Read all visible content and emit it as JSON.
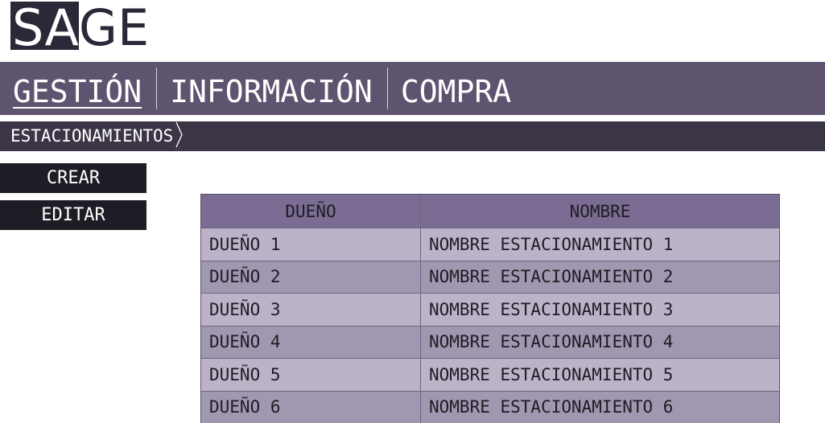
{
  "logo": {
    "part_dark": "SA",
    "part_light": "GE"
  },
  "nav": {
    "items": [
      {
        "label": "GESTIÓN",
        "active": true
      },
      {
        "label": "INFORMACIÓN",
        "active": false
      },
      {
        "label": "COMPRA",
        "active": false
      }
    ]
  },
  "breadcrumb": {
    "label": "ESTACIONAMIENTOS",
    "icon": "chevron-right-icon"
  },
  "actions": {
    "crear": "CREAR",
    "editar": "EDITAR"
  },
  "table": {
    "headers": [
      "DUEÑO",
      "NOMBRE"
    ],
    "rows": [
      [
        "DUEÑO 1",
        "NOMBRE ESTACIONAMIENTO 1"
      ],
      [
        "DUEÑO 2",
        "NOMBRE ESTACIONAMIENTO 2"
      ],
      [
        "DUEÑO 3",
        "NOMBRE ESTACIONAMIENTO 3"
      ],
      [
        "DUEÑO 4",
        "NOMBRE ESTACIONAMIENTO 4"
      ],
      [
        "DUEÑO 5",
        "NOMBRE ESTACIONAMIENTO 5"
      ],
      [
        "DUEÑO 6",
        "NOMBRE ESTACIONAMIENTO 6"
      ]
    ]
  },
  "colors": {
    "nav_bg": "#5f5470",
    "crumb_bg": "#3b3546",
    "button_bg": "#1e1c24",
    "table_header_bg": "#7a6c92",
    "row_light": "#bcb3c8",
    "row_dark": "#a097b1"
  }
}
